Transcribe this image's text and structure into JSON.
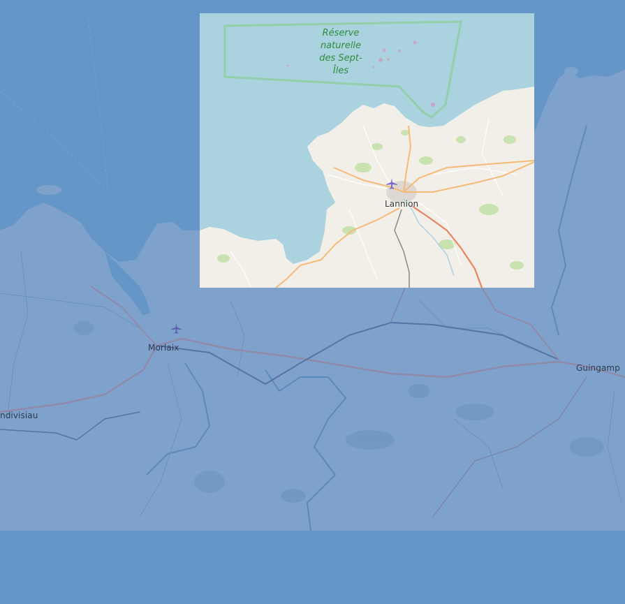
{
  "map": {
    "colors": {
      "page_background": "#6497c7",
      "dimmed_overlay": "#6f98c8",
      "sea": "#aad3df",
      "land": "#f2efe9",
      "reserve_boundary": "#7ecb8e",
      "primary_road": "#f4b06b",
      "trunk_road": "#e8835f",
      "forest": "#c8e2b0"
    },
    "highlighted_area": {
      "places": {
        "lannion": "Lannion",
        "reserve": "Réserve naturelle des Sept-Îles"
      }
    },
    "dimmed_area": {
      "places": {
        "morlaix": "Morlaix",
        "guingamp": "Guingamp",
        "landivisiau": "ndivisiau"
      }
    },
    "icons": [
      "airport-icon",
      "airport-icon"
    ]
  }
}
